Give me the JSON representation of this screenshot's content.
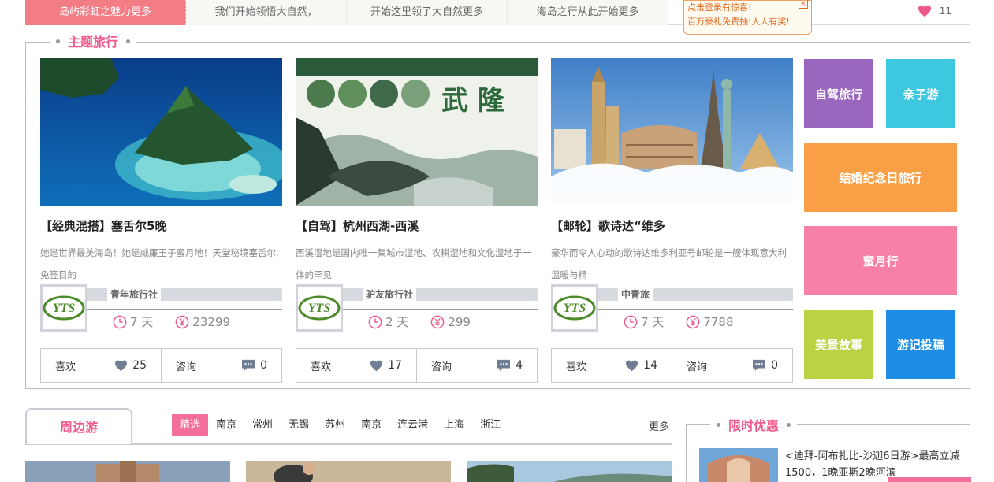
{
  "topbar": {
    "tabs": [
      "岛屿彩虹之魅力更多",
      "我们开始领悟大自然，",
      "开始这里领了大自然更多",
      "海岛之行从此开始更多"
    ],
    "promo_line1": "点击登录有惊喜!",
    "promo_line2": "百万豪礼免费抽!人人有奖!",
    "promo_close": "×",
    "likes": "11"
  },
  "theme": {
    "title": "主题旅行",
    "cards": [
      {
        "title": "【经典混搭】塞舌尔5晚",
        "desc": "她是世界最美海岛！她是威廉王子蜜月地！天堂秘境塞舌尔,免签目的",
        "agency": "青年旅行社",
        "days": "7 天",
        "price": "23299",
        "like_label": "喜欢",
        "likes": "25",
        "consult_label": "咨询",
        "consults": "0"
      },
      {
        "title": "【自驾】杭州西湖-西溪",
        "desc": "西溪湿地是国内唯一集城市湿地、农耕湿地和文化湿地于一体的罕见",
        "agency": "驴友旅行社",
        "days": "2 天",
        "price": "299",
        "like_label": "喜欢",
        "likes": "17",
        "consult_label": "咨询",
        "consults": "4"
      },
      {
        "title": "【邮轮】歌诗达“维多",
        "desc": "豪华而令人心动的歌诗达维多利亚号邮轮是一艘体现意大利温暖与精",
        "agency": "中青旅",
        "days": "7 天",
        "price": "7788",
        "like_label": "喜欢",
        "likes": "14",
        "consult_label": "咨询",
        "consults": "0"
      }
    ],
    "wulong_text": "武 隆",
    "tiles": [
      {
        "label": "自驾旅行",
        "color": "#9b66bd"
      },
      {
        "label": "亲子游",
        "color": "#3ec8e0"
      },
      {
        "label": "结婚纪念日旅行",
        "color": "#f9a046"
      },
      {
        "label": "蜜月行",
        "color": "#f780a6"
      },
      {
        "label": "美景故事",
        "color": "#b9d343"
      },
      {
        "label": "游记投稿",
        "color": "#1e8de6"
      }
    ]
  },
  "nearby": {
    "title": "周边游",
    "cities": [
      "精选",
      "南京",
      "常州",
      "无锡",
      "苏州",
      "南京",
      "连云港",
      "上海",
      "浙江"
    ],
    "more": "更多"
  },
  "limit": {
    "title": "限时优惠",
    "text": "<迪拜-阿布扎比-沙迦6日游>最高立减1500，1晚亚斯2晚河滨"
  }
}
